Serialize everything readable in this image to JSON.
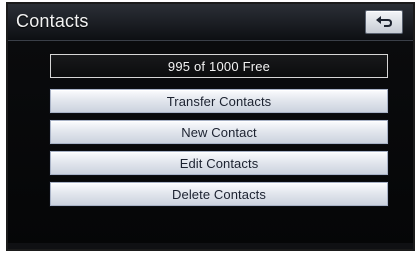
{
  "header": {
    "title": "Contacts",
    "back_icon": "back-arrow-icon"
  },
  "status": {
    "text": "995 of 1000  Free"
  },
  "buttons": [
    {
      "label": "Transfer Contacts"
    },
    {
      "label": "New Contact"
    },
    {
      "label": "Edit Contacts"
    },
    {
      "label": "Delete Contacts"
    }
  ],
  "colors": {
    "background": "#000000",
    "button_face": "#dfe4ec",
    "button_text": "#1c2230"
  }
}
